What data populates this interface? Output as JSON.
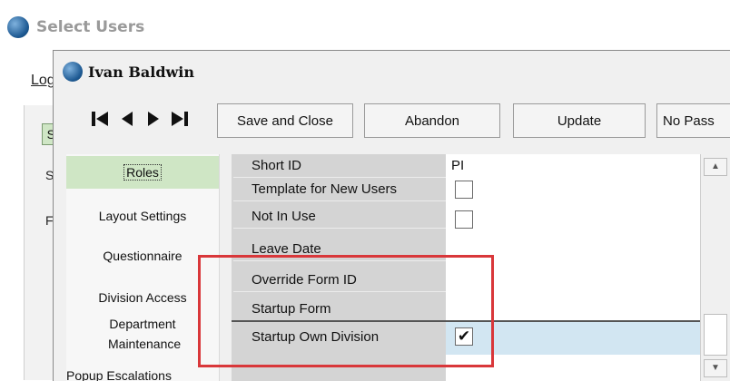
{
  "background_window": {
    "title": "Select Users",
    "log_tab": "Log",
    "selected_item": "S",
    "fragments": [
      "S",
      "F"
    ]
  },
  "dialog": {
    "title": "Ivan Baldwin",
    "nav_icons": [
      "first-record-icon",
      "previous-record-icon",
      "next-record-icon",
      "last-record-icon"
    ],
    "buttons": {
      "save_close": "Save and Close",
      "abandon": "Abandon",
      "update": "Update",
      "no_pass": "No Pass"
    },
    "sidebar": {
      "items": [
        {
          "label": "Roles"
        },
        {
          "label": "Layout Settings"
        },
        {
          "label": "Questionnaire"
        },
        {
          "label": "Division Access"
        },
        {
          "label": "Department Maintenance"
        },
        {
          "label": "Popup Escalations"
        }
      ]
    },
    "grid": {
      "rows": [
        {
          "label": "Short ID",
          "value": "PI"
        },
        {
          "label": "Template for New Users",
          "checked": false
        },
        {
          "label": "Not In Use",
          "checked": false
        },
        {
          "label": "Leave Date",
          "value": ""
        },
        {
          "label": "Override Form ID",
          "value": ""
        },
        {
          "label": "Startup Form",
          "value": ""
        },
        {
          "label": "Startup Own Division",
          "checked": true
        }
      ],
      "check_glyph": "✔"
    },
    "scrollbar": {
      "up": "▲",
      "down": "▼"
    },
    "colors": {
      "selected_nav": "#cfe6c5",
      "highlight_row": "#d2e6f2",
      "annotation": "#d9373a"
    }
  }
}
